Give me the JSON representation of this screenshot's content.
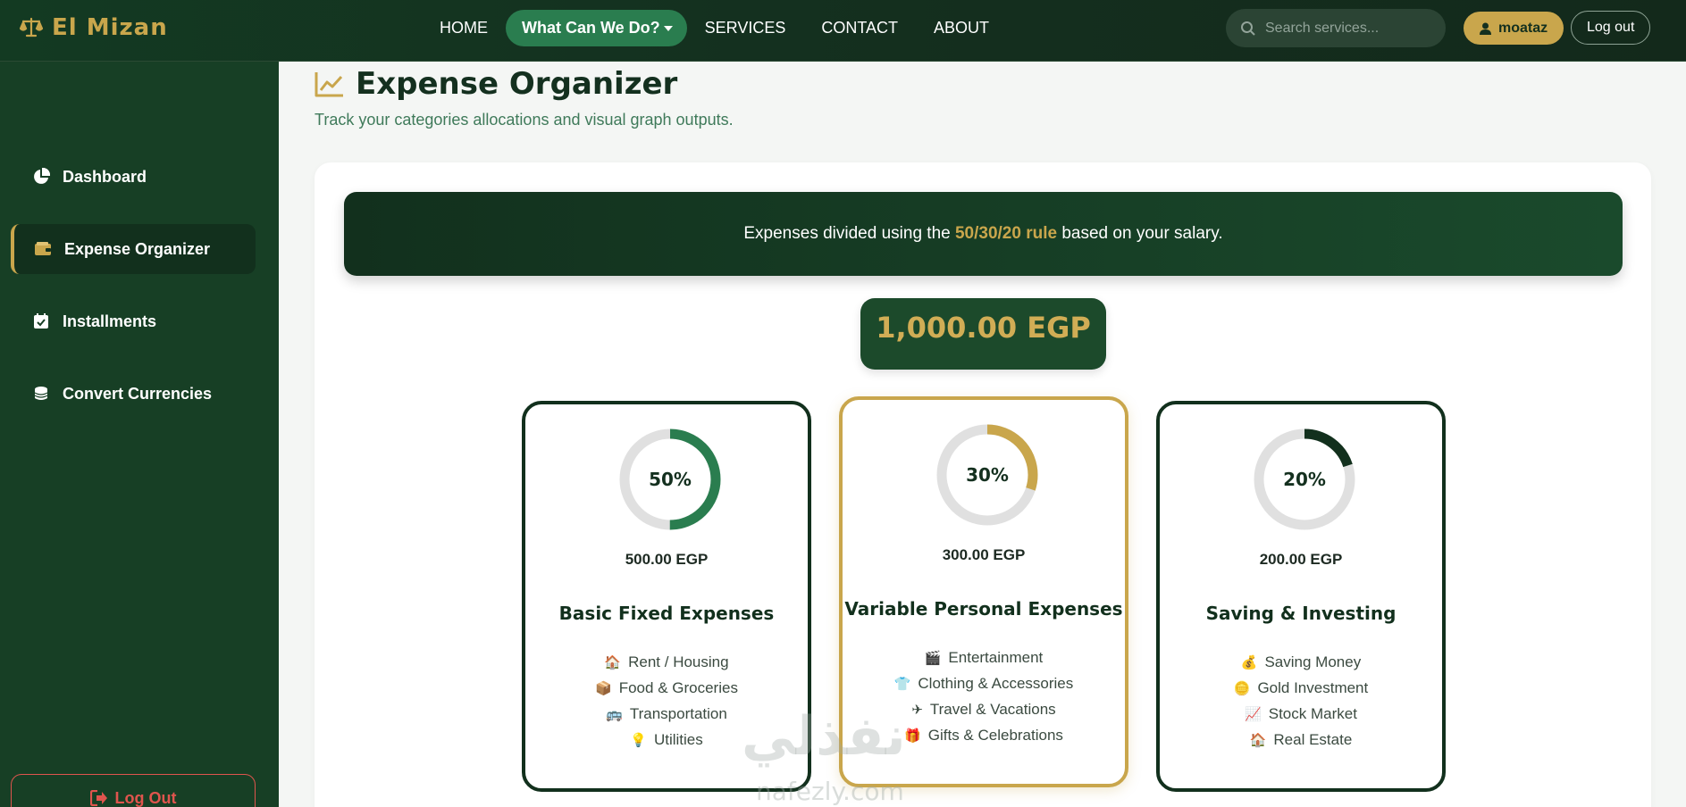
{
  "brand": {
    "name": "El Mizan",
    "icon": "scale-icon"
  },
  "nav": {
    "home": "HOME",
    "what": "What Can We Do?",
    "services": "SERVICES",
    "contact": "CONTACT",
    "about": "ABOUT"
  },
  "search": {
    "placeholder": "Search services..."
  },
  "user": {
    "name": "moataz",
    "logout": "Log out"
  },
  "sidebar": {
    "items": [
      {
        "label": "Dashboard",
        "icon": "pie-chart-icon"
      },
      {
        "label": "Expense Organizer",
        "icon": "wallet-icon",
        "active": true
      },
      {
        "label": "Installments",
        "icon": "calendar-check-icon"
      },
      {
        "label": "Convert Currencies",
        "icon": "coins-icon"
      }
    ],
    "logout": "Log Out"
  },
  "page": {
    "title": "Expense Organizer",
    "subtitle": "Track your categories allocations and visual graph outputs.",
    "banner_pre": "Expenses divided using the ",
    "banner_rule": "50/30/20 rule",
    "banner_post": " based on your salary.",
    "salary": "1,000.00 EGP"
  },
  "colors": {
    "accent": "#c9a64c",
    "green": "#2a7d4f",
    "dark": "#12301d",
    "track": "#e0e0e0"
  },
  "cards": [
    {
      "percent_label": "50%",
      "percent": 50,
      "amount": "500.00 EGP",
      "title": "Basic Fixed Expenses",
      "ring_color": "#2a7d4f",
      "items": [
        {
          "icon": "🏠",
          "label": "Rent / Housing"
        },
        {
          "icon": "📦",
          "label": "Food & Groceries"
        },
        {
          "icon": "🚌",
          "label": "Transportation"
        },
        {
          "icon": "💡",
          "label": "Utilities"
        }
      ]
    },
    {
      "percent_label": "30%",
      "percent": 30,
      "amount": "300.00 EGP",
      "title": "Variable Personal Expenses",
      "ring_color": "#c9a64c",
      "items": [
        {
          "icon": "🎬",
          "label": "Entertainment"
        },
        {
          "icon": "👕",
          "label": "Clothing & Accessories"
        },
        {
          "icon": "✈",
          "label": "Travel & Vacations"
        },
        {
          "icon": "🎁",
          "label": "Gifts & Celebrations"
        }
      ]
    },
    {
      "percent_label": "20%",
      "percent": 20,
      "amount": "200.00 EGP",
      "title": "Saving & Investing",
      "ring_color": "#12301d",
      "items": [
        {
          "icon": "💰",
          "label": "Saving Money"
        },
        {
          "icon": "🪙",
          "label": "Gold Investment"
        },
        {
          "icon": "📈",
          "label": "Stock Market"
        },
        {
          "icon": "🏠",
          "label": "Real Estate"
        }
      ]
    }
  ],
  "watermark": {
    "text": "نفذلي",
    "url": "nafezly.com"
  }
}
